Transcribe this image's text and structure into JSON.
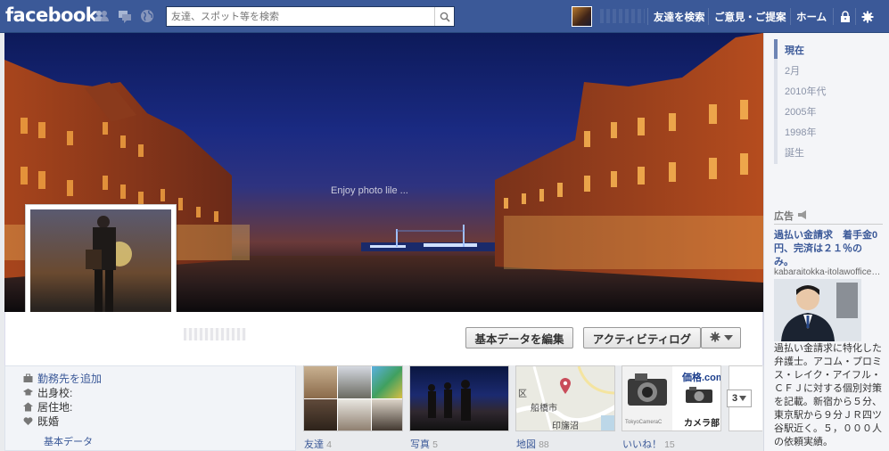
{
  "topbar": {
    "logo": "facebook",
    "search_placeholder": "友達、スポット等を検索",
    "nav": [
      "友達を検索",
      "ご意見・ご提案",
      "ホーム"
    ]
  },
  "cover": {
    "caption": "Enjoy photo lile ..."
  },
  "actions": {
    "edit_profile": "基本データを編集",
    "activity_log": "アクティビティログ"
  },
  "info": {
    "add_work": "勤務先を追加",
    "school": "出身校:",
    "lives_in": "居住地:",
    "relationship": "既婚",
    "about_link": "基本データ"
  },
  "apps": [
    {
      "label": "友達",
      "count": "4"
    },
    {
      "label": "写真",
      "count": "5"
    },
    {
      "label": "地図",
      "count": "88"
    },
    {
      "label": "いいね！",
      "count": "15"
    }
  ],
  "map": {
    "label_ward": "区",
    "label_city": "船橋市",
    "label_station": "印旛沼"
  },
  "like_tile": {
    "brand": "価格.com",
    "sub": "カメラ部",
    "camera_text": "TokyoCameraC"
  },
  "more_count": "3",
  "timeline": [
    "現在",
    "2月",
    "2010年代",
    "2005年",
    "1998年",
    "誕生"
  ],
  "ads": {
    "header": "広告",
    "title": "過払い金請求　着手金0円、完済は２１％のみ。",
    "url": "kabaraitokka-itolawoffice.com",
    "body": "過払い金請求に特化した弁護士。アコム・プロミス・レイク・アイフル・ＣＦＪに対する個別対策を記載。新宿から５分、東京駅から９分ＪＲ四ツ谷駅近く。５，０００人の依頼実績。"
  }
}
